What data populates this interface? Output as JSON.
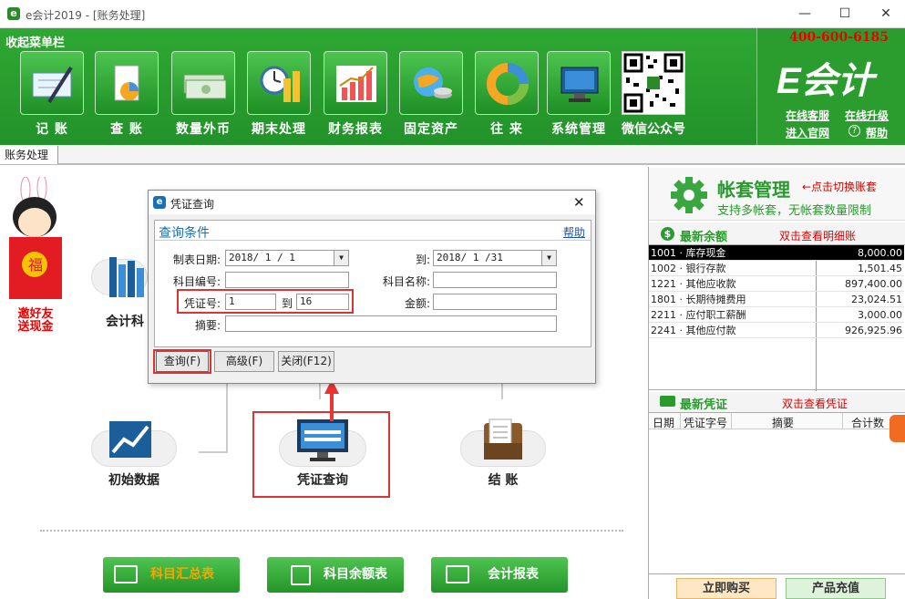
{
  "window": {
    "title": "e会计2019 - [账务处理]",
    "min": "—",
    "max": "☐",
    "close": "✕"
  },
  "ribbon": {
    "collapse_label": "收起菜单栏",
    "tools": [
      {
        "label": "记  账",
        "icon": "check-pen-icon"
      },
      {
        "label": "查  账",
        "icon": "document-chart-icon"
      },
      {
        "label": "数量外币",
        "icon": "banknotes-icon"
      },
      {
        "label": "期末处理",
        "icon": "clock-coins-icon"
      },
      {
        "label": "财务报表",
        "icon": "bar-chart-icon"
      },
      {
        "label": "固定资产",
        "icon": "globe-coins-icon"
      },
      {
        "label": "往  来",
        "icon": "donut-icon"
      },
      {
        "label": "系统管理",
        "icon": "monitor-icon"
      }
    ],
    "wechat_label": "微信公众号",
    "phone": "400-600-6185",
    "brand": "E会计",
    "links": {
      "online_service": "在线客服",
      "online_upgrade": "在线升级",
      "website": "进入官网",
      "help": "帮助"
    }
  },
  "tab": {
    "label": "账务处理"
  },
  "promo": {
    "line1": "邀好友",
    "line2": "送现金"
  },
  "flow": {
    "accounting_subject": "会计科",
    "initial_data": "初始数据",
    "voucher_query": "凭证查询",
    "closing": "结  账"
  },
  "bottom_buttons": {
    "subject_summary": "科目汇总表",
    "subject_balance": "科目余额表",
    "accounting_report": "会计报表"
  },
  "side": {
    "title": "帐套管理",
    "switch_hint": "←点击切换账套",
    "subtitle": "支持多帐套，无帐套数量限制",
    "balance_title": "最新余额",
    "balance_hint": "双击查看明细账",
    "balances": [
      {
        "account": "1001 · 库存现金",
        "amount": "8,000.00"
      },
      {
        "account": "1002 · 银行存款",
        "amount": "1,501.45"
      },
      {
        "account": "1221 · 其他应收款",
        "amount": "897,400.00"
      },
      {
        "account": "1801 · 长期待摊费用",
        "amount": "23,024.51"
      },
      {
        "account": "2211 · 应付职工薪酬",
        "amount": "3,000.00"
      },
      {
        "account": "2241 · 其他应付款",
        "amount": "926,925.96"
      }
    ],
    "voucher_title": "最新凭证",
    "voucher_hint": "双击查看凭证",
    "voucher_columns": [
      "日期",
      "凭证字号",
      "摘要",
      "合计数"
    ],
    "buy_now": "立即购买",
    "recharge": "产品充值"
  },
  "dialog": {
    "title": "凭证查询",
    "close": "✕",
    "section": "查询条件",
    "help": "帮助",
    "fields": {
      "date_label": "制表日期:",
      "date_from": "2018/ 1 / 1",
      "to_label": "到:",
      "date_to": "2018/ 1 /31",
      "subject_code_label": "科目编号:",
      "subject_code": "",
      "subject_name_label": "科目名称:",
      "subject_name": "",
      "voucher_no_label": "凭证号:",
      "voucher_from": "1",
      "voucher_to_label": "到",
      "voucher_to": "16",
      "amount_label": "金额:",
      "amount": "",
      "summary_label": "摘要:",
      "summary": ""
    },
    "buttons": {
      "query": "查询(F)",
      "advanced": "高级(F)",
      "close": "关闭(F12)"
    }
  },
  "colors": {
    "ribbon_green": "#22922a",
    "highlight_red": "#dd3333",
    "phone_red": "#e00000"
  }
}
